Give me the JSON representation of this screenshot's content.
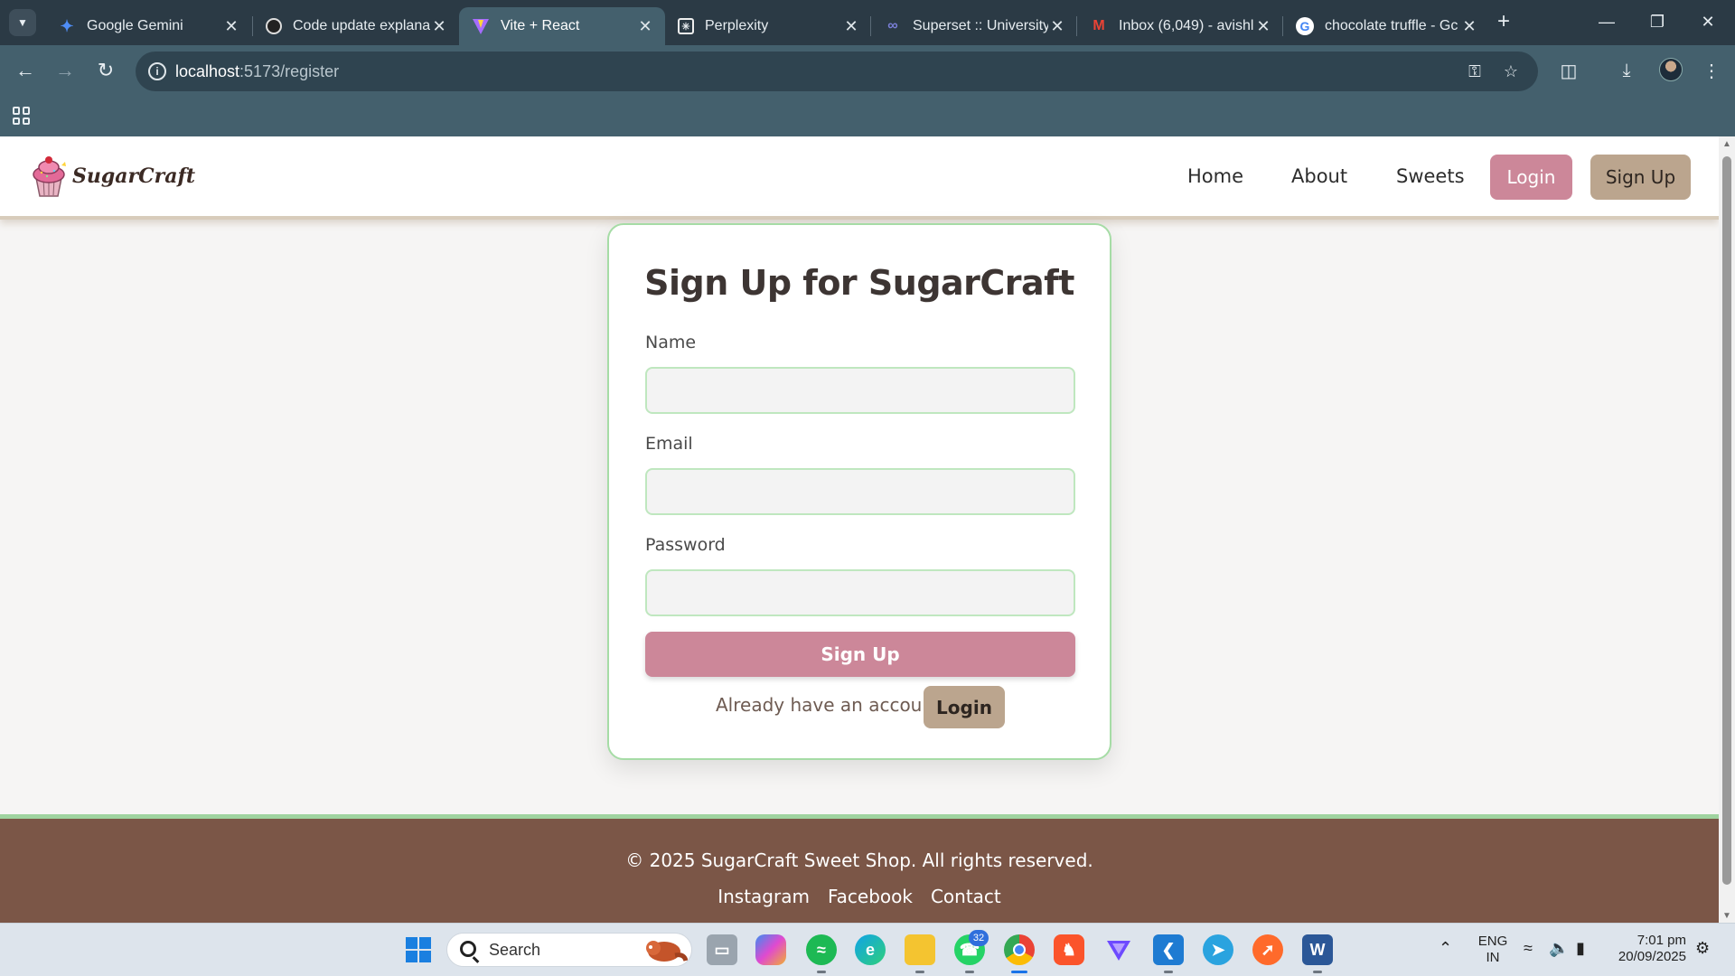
{
  "browser": {
    "tabs": [
      {
        "title": "Google Gemini",
        "icon": "gemini-icon"
      },
      {
        "title": "Code update explana",
        "icon": "chatgpt-icon"
      },
      {
        "title": "Vite + React",
        "icon": "vite-icon"
      },
      {
        "title": "Perplexity",
        "icon": "perplexity-icon"
      },
      {
        "title": "Superset :: University",
        "icon": "superset-icon"
      },
      {
        "title": "Inbox (6,049) - avishl",
        "icon": "gmail-icon"
      },
      {
        "title": "chocolate truffle - Gc",
        "icon": "google-icon"
      }
    ],
    "url_host": "localhost",
    "url_path": ":5173/register"
  },
  "site": {
    "brand": "SugarCraft",
    "nav": {
      "home": "Home",
      "about": "About",
      "sweets": "Sweets",
      "login": "Login",
      "signup": "Sign Up"
    },
    "colors": {
      "pink": "#cc8799",
      "tan": "#bba58e",
      "green_border": "#a6dca6",
      "footer_brown": "#7b5647"
    }
  },
  "form": {
    "title": "Sign Up for SugarCraft",
    "name_label": "Name",
    "name_value": "",
    "email_label": "Email",
    "email_value": "",
    "password_label": "Password",
    "password_value": "",
    "submit_label": "Sign Up",
    "already_text": "Already have an account?",
    "login_label": "Login"
  },
  "footer": {
    "copyright": "© 2025 SugarCraft Sweet Shop. All rights reserved.",
    "links": [
      "Instagram",
      "Facebook",
      "Contact"
    ]
  },
  "taskbar": {
    "search_placeholder": "Search",
    "whatsapp_badge": "32",
    "language": "ENG",
    "region": "IN",
    "time": "7:01 pm",
    "date": "20/09/2025"
  }
}
